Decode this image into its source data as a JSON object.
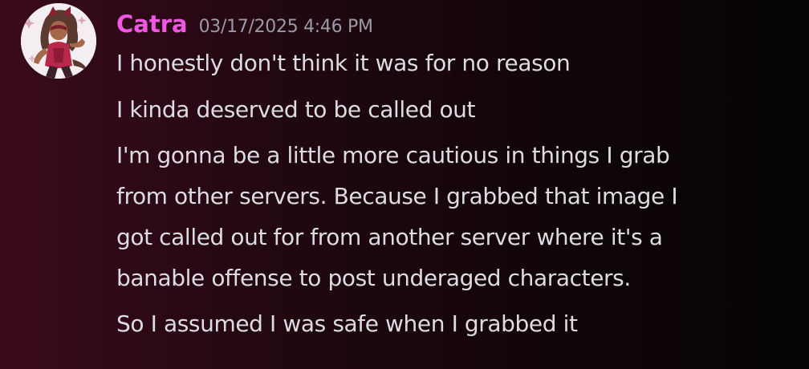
{
  "message": {
    "author": {
      "name": "Catra",
      "name_color": "#f057e3",
      "avatar": "catra-avatar"
    },
    "timestamp": "03/17/2025 4:46 PM",
    "lines": [
      "I honestly don't think it was for no reason",
      "I kinda deserved to be called out",
      "I'm gonna be a little more cautious in things I grab",
      "from other servers. Because I grabbed that image I",
      "got called out for from another server where it's a",
      "banable offense to post underaged characters.",
      "So I assumed I was safe when I grabbed it"
    ]
  },
  "colors": {
    "background_left": "#3a0a1c",
    "background_right": "#050303",
    "text": "#dcdce2",
    "timestamp": "#9b9aa6"
  }
}
